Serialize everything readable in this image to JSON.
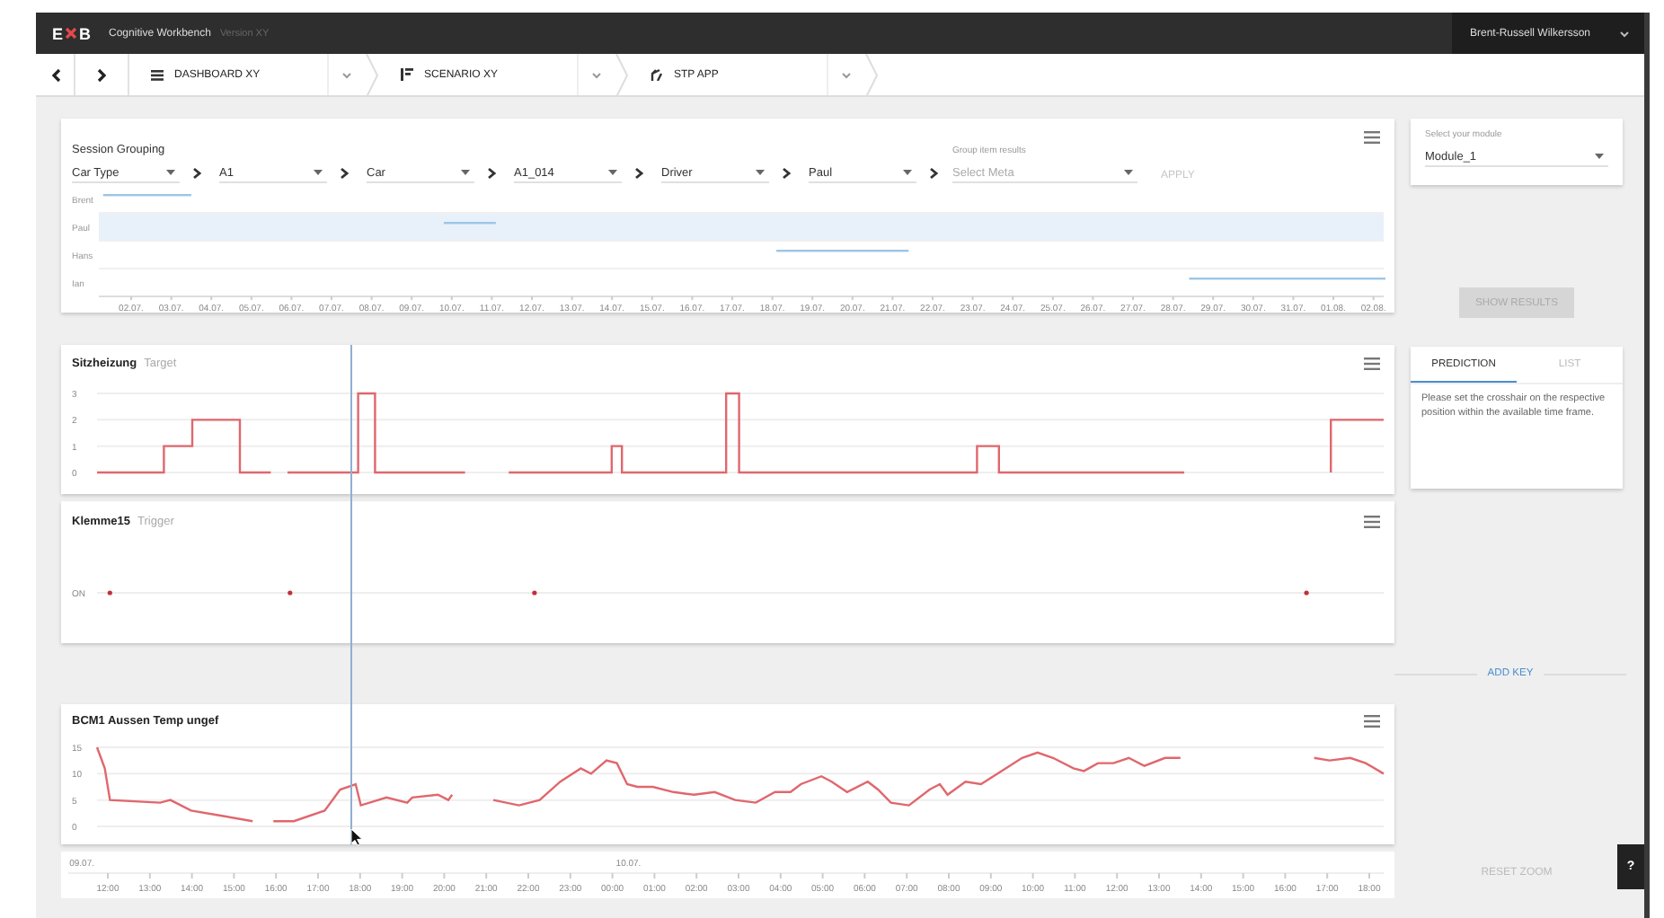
{
  "header": {
    "logo": [
      "E",
      "B"
    ],
    "app_name": "Cognitive Workbench",
    "version": "Version XY",
    "user": "Brent-Russell Wilkersson"
  },
  "nav": {
    "crumbs": [
      {
        "label": "DASHBOARD XY",
        "kind": "list"
      },
      {
        "label": "SCENARIO XY",
        "kind": "bars"
      },
      {
        "label": "STP APP",
        "kind": "fork"
      }
    ]
  },
  "session": {
    "title": "Session Grouping",
    "filters": [
      {
        "value": "Car Type"
      },
      {
        "value": "A1"
      },
      {
        "value": "Car"
      },
      {
        "value": "A1_014"
      },
      {
        "value": "Driver"
      },
      {
        "value": "Paul"
      }
    ],
    "meta": {
      "label": "Group item results",
      "placeholder": "Select Meta"
    },
    "apply": {
      "label": "APPLY",
      "disabled": true
    },
    "timeline": {
      "rows": [
        {
          "label": "Brent",
          "selected": false
        },
        {
          "label": "Paul",
          "selected": true
        },
        {
          "label": "Hans",
          "selected": false
        },
        {
          "label": "Ian",
          "selected": false
        }
      ],
      "dates": [
        "02.07.",
        "03.07.",
        "04.07.",
        "05.07.",
        "06.07.",
        "07.07.",
        "08.07.",
        "09.07.",
        "10.07.",
        "11.07.",
        "12.07.",
        "13.07.",
        "14.07.",
        "15.07.",
        "16.07.",
        "17.07.",
        "18.07.",
        "19.07.",
        "20.07.",
        "21.07.",
        "22.07.",
        "23.07.",
        "24.07.",
        "25.07.",
        "26.07.",
        "27.07.",
        "28.07.",
        "29.07.",
        "30.07.",
        "31.07.",
        "01.08.",
        "02.08."
      ]
    }
  },
  "module": {
    "label": "Select your module",
    "value": "Module_1"
  },
  "show_results": {
    "label": "SHOW RESULTS",
    "disabled": true
  },
  "prediction": {
    "tabs": [
      {
        "label": "PREDICTION",
        "selected": true
      },
      {
        "label": "LIST",
        "selected": false
      }
    ],
    "text": "Please set the crosshair on the respective position within the available time frame."
  },
  "charts": [
    {
      "title": "Sitzheizung",
      "subtitle": "Target",
      "kind": "step",
      "y_labels": [
        "3",
        "2",
        "1",
        "0"
      ]
    },
    {
      "title": "Klemme15",
      "subtitle": "Trigger",
      "kind": "dots",
      "y_labels": [
        "ON"
      ]
    },
    {
      "title": "BCM1 Aussen Temp ungef",
      "kind": "line",
      "y_labels": [
        "15",
        "10",
        "5",
        "0"
      ]
    }
  ],
  "time_axis": {
    "dates": [
      "09.07.",
      "10.07."
    ],
    "hours": [
      "12:00",
      "13:00",
      "14:00",
      "15:00",
      "16:00",
      "17:00",
      "18:00",
      "19:00",
      "20:00",
      "21:00",
      "22:00",
      "23:00",
      "00:00",
      "01:00",
      "02:00",
      "03:00",
      "04:00",
      "05:00",
      "06:00",
      "07:00",
      "08:00",
      "09:00",
      "10:00",
      "11:00",
      "12:00",
      "13:00",
      "14:00",
      "15:00",
      "16:00",
      "17:00",
      "18:00"
    ]
  },
  "add_key": "ADD KEY",
  "reset_zoom": "RESET ZOOM",
  "help": "?"
}
